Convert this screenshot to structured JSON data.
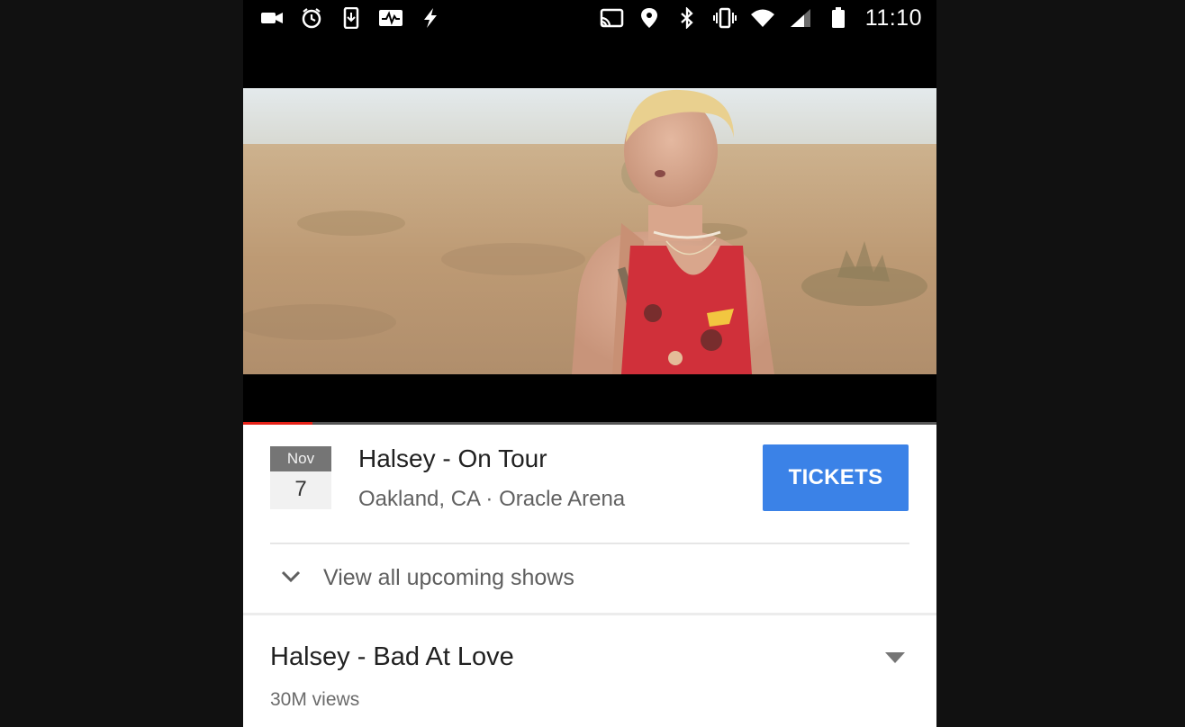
{
  "status_bar": {
    "time": "11:10",
    "left_icons": [
      "videocam-icon",
      "alarm-icon",
      "download-icon",
      "activity-icon",
      "flash-icon"
    ],
    "right_icons": [
      "cast-icon",
      "location-icon",
      "bluetooth-icon",
      "vibrate-icon",
      "wifi-icon",
      "signal-icon",
      "battery-icon"
    ]
  },
  "player": {
    "progress": 0.1,
    "progress_color": "#e62117"
  },
  "event": {
    "month": "Nov",
    "day": "7",
    "title": "Halsey - On Tour",
    "location": "Oakland, CA · Oracle Arena",
    "tickets_label": "TICKETS",
    "tickets_color": "#3b82e7"
  },
  "upcoming": {
    "label": "View all upcoming shows",
    "icon": "chevron-down-icon"
  },
  "video": {
    "title": "Halsey - Bad At Love",
    "views": "30M views",
    "expand_icon": "expand-arrow-icon"
  }
}
